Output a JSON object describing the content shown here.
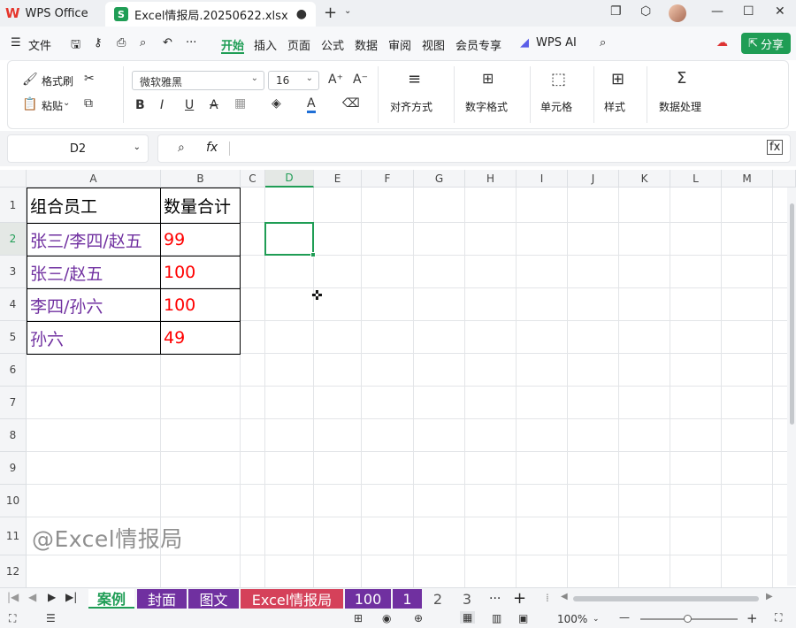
{
  "titlebar": {
    "app_name": "WPS Office",
    "file_tab": "Excel情报局.20250622.xlsx",
    "new_tab": "+"
  },
  "menubar": {
    "file": "文件",
    "items": [
      "开始",
      "插入",
      "页面",
      "公式",
      "数据",
      "审阅",
      "视图",
      "会员专享"
    ],
    "ai": "WPS AI",
    "share": "分享"
  },
  "ribbon": {
    "format_painter": "格式刷",
    "paste": "粘贴",
    "font_name": "微软雅黑",
    "font_size": "16",
    "align": "对齐方式",
    "number_format": "数字格式",
    "cell": "单元格",
    "style": "样式",
    "data_processing": "数据处理"
  },
  "formula_bar": {
    "name_box": "D2",
    "fx": "fx"
  },
  "columns": [
    "A",
    "B",
    "C",
    "D",
    "E",
    "F",
    "G",
    "H",
    "I",
    "J",
    "K",
    "L",
    "M"
  ],
  "rows": [
    "1",
    "2",
    "3",
    "4",
    "5",
    "6",
    "7",
    "8",
    "9",
    "10",
    "11",
    "12"
  ],
  "table": {
    "header_a": "组合员工",
    "header_b": "数量合计",
    "rows": [
      {
        "a": "张三/李四/赵五",
        "b": "99"
      },
      {
        "a": "张三/赵五",
        "b": "100"
      },
      {
        "a": "李四/孙六",
        "b": "100"
      },
      {
        "a": "孙六",
        "b": "49"
      }
    ]
  },
  "watermark": "@Excel情报局",
  "sheets": [
    {
      "label": "案例",
      "color": "#ffffff"
    },
    {
      "label": "封面",
      "color": "#7030a0"
    },
    {
      "label": "图文",
      "color": "#7030a0"
    },
    {
      "label": "Excel情报局",
      "color": "#d5415a"
    },
    {
      "label": "100",
      "color": "#7030a0"
    },
    {
      "label": "1",
      "color": "#7030a0"
    },
    {
      "label": "2",
      "color": ""
    },
    {
      "label": "3",
      "color": ""
    }
  ],
  "sheet_more": "···",
  "status": {
    "zoom": "100%"
  },
  "colors": {
    "accent": "#1f9d55",
    "name_text": "#7030a0",
    "value_text": "#ff0000"
  }
}
